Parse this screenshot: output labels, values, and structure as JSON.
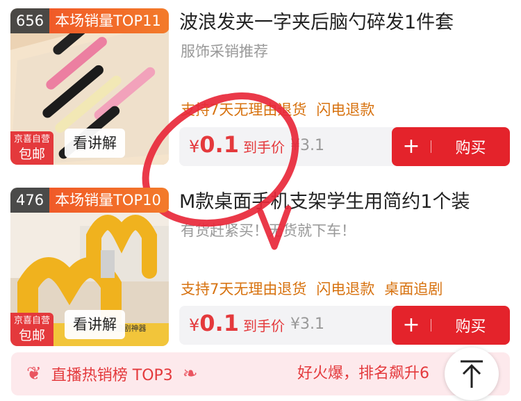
{
  "products": [
    {
      "rank": "656",
      "rank_label": "本场销量TOP11",
      "badge_line1": "京喜自营",
      "badge_line2": "包邮",
      "explain": "看讲解",
      "title": "波浪发夹一字夹后脑勺碎发1件套",
      "subtitle": "服饰采销推荐",
      "tags": [
        "支持7天无理由退货",
        "闪电退款"
      ],
      "price_symbol": "¥",
      "price": "0.1",
      "price_label": "到手价",
      "original_price": "¥3.1",
      "add_label": "+",
      "buy_label": "购买"
    },
    {
      "rank": "476",
      "rank_label": "本场销量TOP10",
      "badge_line1": "京喜自营",
      "badge_line2": "包邮",
      "explain": "看讲解",
      "title": "M款桌面手机支架学生用简约1个装",
      "subtitle": "有货赶紧买！无货就下车！",
      "tags": [
        "支持7天无理由退货",
        "闪电退款",
        "桌面追剧"
      ],
      "price_symbol": "¥",
      "price": "0.1",
      "price_label": "到手价",
      "original_price": "¥3.1",
      "add_label": "+",
      "buy_label": "购买",
      "image_text": "能追剧神器"
    }
  ],
  "hot_banner": {
    "label": "直播热销榜 TOP3",
    "right_text": "好火爆，排名飙升6"
  },
  "icons": {
    "back_top": "back-to-top-icon",
    "laurel": "laurel-icon"
  },
  "colors": {
    "accent_red": "#e4393c",
    "tag_orange": "#d7720f",
    "rank_orange": "#f05a28"
  }
}
